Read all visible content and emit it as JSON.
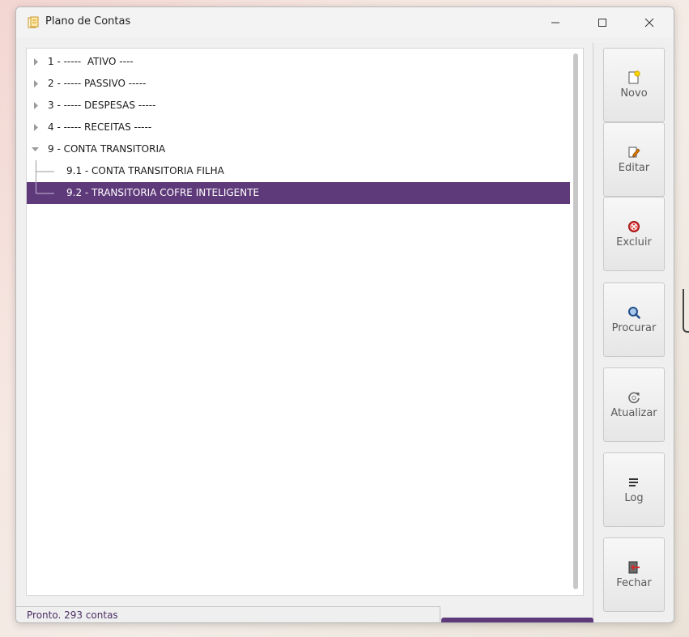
{
  "window": {
    "title": "Plano de Contas"
  },
  "tree": {
    "items": [
      {
        "label": "1 - -----  ATIVO ----",
        "level": 0,
        "expanded": false,
        "selected": false
      },
      {
        "label": "2 - ----- PASSIVO -----",
        "level": 0,
        "expanded": false,
        "selected": false
      },
      {
        "label": "3 - ----- DESPESAS -----",
        "level": 0,
        "expanded": false,
        "selected": false
      },
      {
        "label": "4 - ----- RECEITAS -----",
        "level": 0,
        "expanded": false,
        "selected": false
      },
      {
        "label": "9 - CONTA TRANSITORIA",
        "level": 0,
        "expanded": true,
        "selected": false
      },
      {
        "label": "9.1 - CONTA TRANSITORIA FILHA",
        "level": 1,
        "expanded": false,
        "selected": false
      },
      {
        "label": "9.2 - TRANSITORIA COFRE INTELIGENTE",
        "level": 1,
        "expanded": false,
        "selected": true
      }
    ]
  },
  "toolbar": {
    "novo": "Novo",
    "editar": "Editar",
    "excluir": "Excluir",
    "procurar": "Procurar",
    "atualizar": "Atualizar",
    "log": "Log",
    "fechar": "Fechar"
  },
  "status": {
    "text": "Pronto. 293 contas"
  },
  "colors": {
    "selection": "#5f3a7a",
    "status_text": "#4b2f63"
  }
}
